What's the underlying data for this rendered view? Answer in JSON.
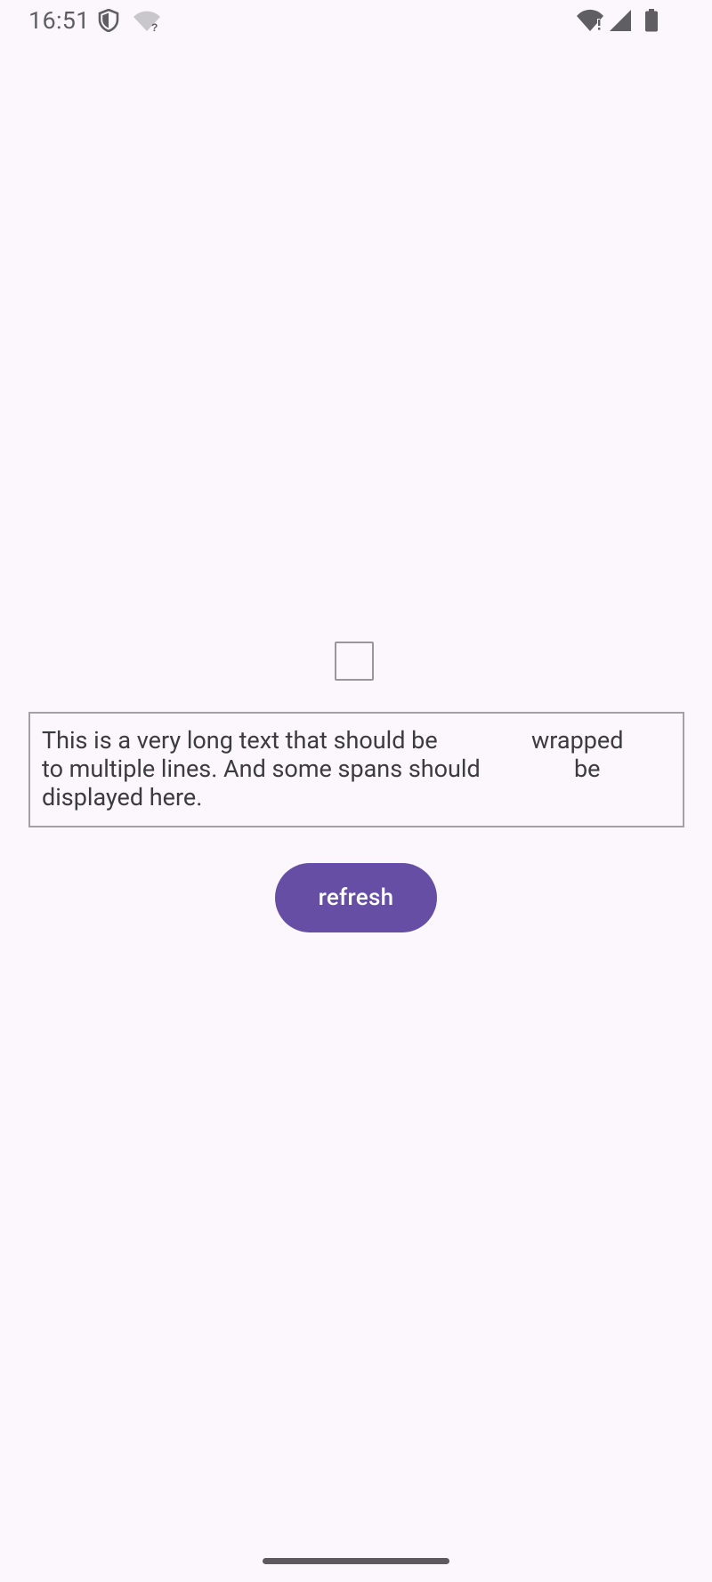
{
  "status_bar": {
    "time": "16:51",
    "left_icons": [
      "shield-icon",
      "wifi-question-icon"
    ],
    "right_icons": [
      "wifi-alert-icon",
      "cellular-signal-icon",
      "battery-icon"
    ]
  },
  "main": {
    "checkbox": {
      "checked": false
    },
    "long_text": {
      "line1": "This is a very long text that should be",
      "line1_span": "wrapped",
      "line2": "to multiple lines. And some spans should",
      "line2_span": "be",
      "line3": "displayed here."
    },
    "refresh_button": {
      "label": "refresh"
    }
  },
  "colors": {
    "background": "#fcf7fc",
    "accent": "#654ea3",
    "text": "#3c3b40",
    "border": "#a3a0a6"
  }
}
